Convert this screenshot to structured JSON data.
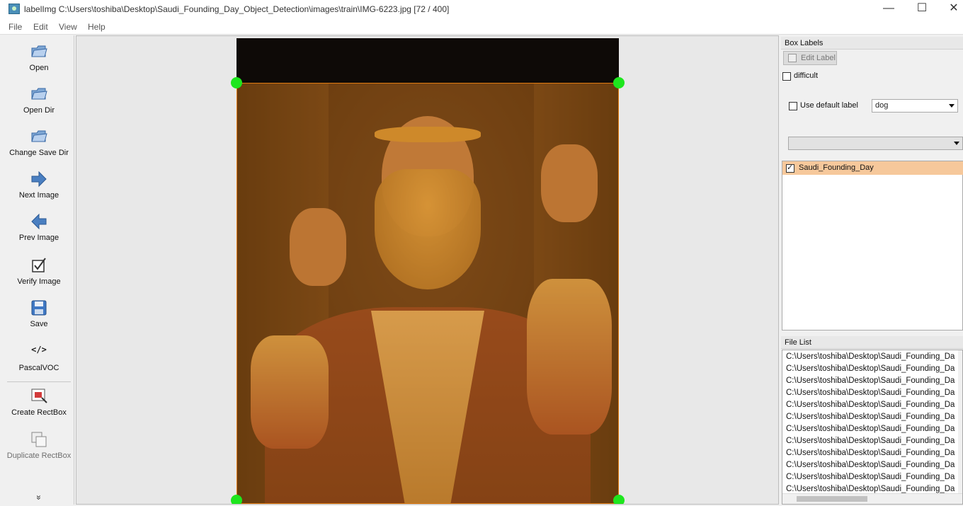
{
  "window": {
    "title": "labelImg C:\\Users\\toshiba\\Desktop\\Saudi_Founding_Day_Object_Detection\\images\\train\\IMG-6223.jpg [72 / 400]",
    "minimize": "—",
    "maximize": "☐",
    "close": "✕"
  },
  "menu": [
    "File",
    "Edit",
    "View",
    "Help"
  ],
  "toolbar": {
    "open": "Open",
    "open_dir": "Open Dir",
    "change_save_dir": "Change Save Dir",
    "next_image": "Next Image",
    "prev_image": "Prev Image",
    "verify_image": "Verify Image",
    "save": "Save",
    "format_icon": "</>",
    "format": "PascalVOC",
    "create_rectbox": "Create RectBox",
    "duplicate_rectbox": "Duplicate RectBox",
    "more": "»"
  },
  "box_labels": {
    "title": "Box Labels",
    "edit_label": "Edit Label",
    "difficult": "difficult",
    "difficult_checked": false,
    "use_default_label": "Use default label",
    "use_default_checked": false,
    "default_label_value": "dog",
    "second_combo_value": "",
    "labels": [
      {
        "name": "Saudi_Founding_Day",
        "checked": true
      }
    ]
  },
  "file_list": {
    "title": "File List",
    "items": [
      "C:\\Users\\toshiba\\Desktop\\Saudi_Founding_Da",
      "C:\\Users\\toshiba\\Desktop\\Saudi_Founding_Da",
      "C:\\Users\\toshiba\\Desktop\\Saudi_Founding_Da",
      "C:\\Users\\toshiba\\Desktop\\Saudi_Founding_Da",
      "C:\\Users\\toshiba\\Desktop\\Saudi_Founding_Da",
      "C:\\Users\\toshiba\\Desktop\\Saudi_Founding_Da",
      "C:\\Users\\toshiba\\Desktop\\Saudi_Founding_Da",
      "C:\\Users\\toshiba\\Desktop\\Saudi_Founding_Da",
      "C:\\Users\\toshiba\\Desktop\\Saudi_Founding_Da",
      "C:\\Users\\toshiba\\Desktop\\Saudi_Founding_Da",
      "C:\\Users\\toshiba\\Desktop\\Saudi_Founding_Da",
      "C:\\Users\\toshiba\\Desktop\\Saudi_Founding_Da"
    ]
  },
  "colors": {
    "box_border": "#e07a10",
    "box_fill": "#d67814",
    "handle": "#1ee61e",
    "selected_label_row": "#f6c89b"
  }
}
